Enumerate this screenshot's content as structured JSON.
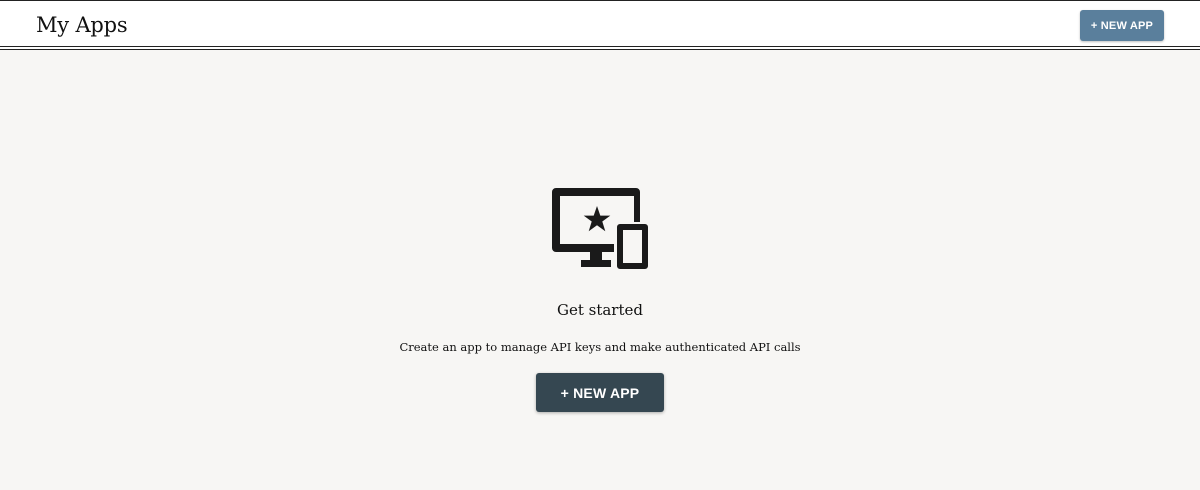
{
  "header": {
    "title": "My Apps",
    "new_app_label": "+ NEW APP",
    "button_color": "#5a7f9c"
  },
  "empty_state": {
    "icon": "devices-star-icon",
    "title": "Get started",
    "subtitle": "Create an app to manage API keys and make authenticated API calls",
    "new_app_label": "+ NEW APP",
    "button_color": "#354751"
  },
  "colors": {
    "page_background": "#f7f6f4",
    "header_background": "#ffffff",
    "text": "#111111"
  }
}
